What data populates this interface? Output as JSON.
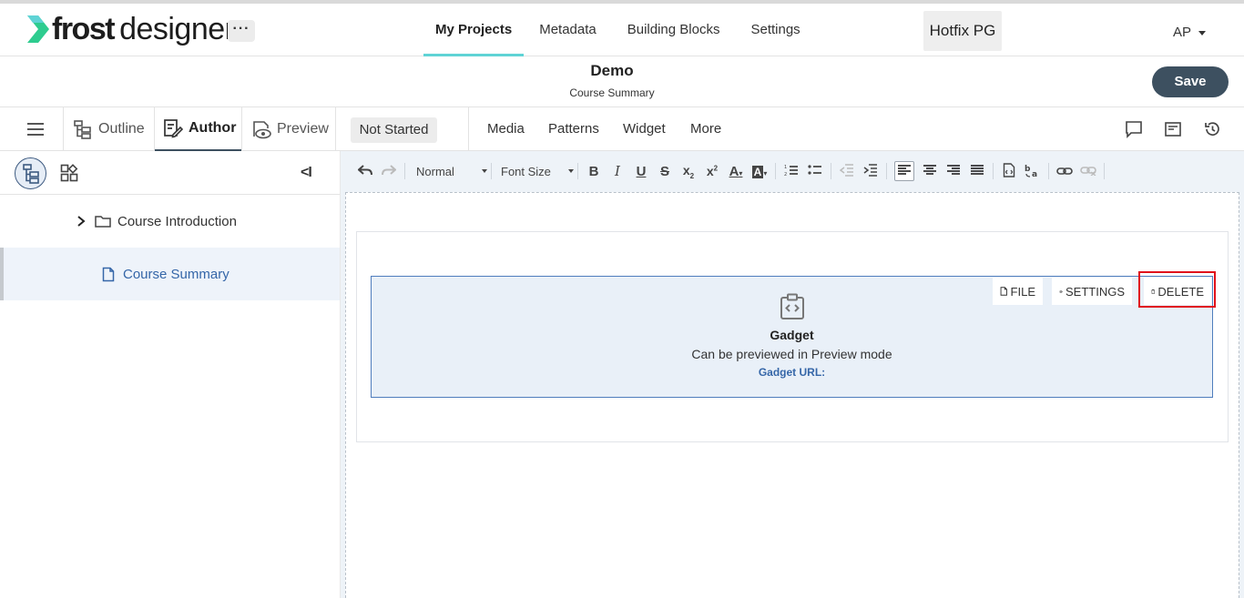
{
  "header": {
    "logo_bold": "frost",
    "logo_light": "designer",
    "more_label": "···",
    "nav": [
      "My Projects",
      "Metadata",
      "Building Blocks",
      "Settings"
    ],
    "project": "Hotfix PG",
    "user": "AP"
  },
  "document": {
    "title": "Demo",
    "subtitle": "Course Summary",
    "save_label": "Save"
  },
  "modes": {
    "outline": "Outline",
    "author": "Author",
    "preview": "Preview",
    "status": "Not Started",
    "insert": [
      "Media",
      "Patterns",
      "Widget",
      "More"
    ]
  },
  "sidebar": {
    "collapse_label": "<I",
    "items": [
      {
        "label": "Course Introduction"
      },
      {
        "label": "Course Summary"
      }
    ]
  },
  "toolbar": {
    "format": "Normal",
    "font_size": "Font Size"
  },
  "gadget": {
    "file_label": "FILE",
    "settings_label": "SETTINGS",
    "delete_label": "DELETE",
    "title": "Gadget",
    "description": "Can be previewed in Preview mode",
    "url_label": "Gadget URL:"
  },
  "colors": {
    "accent": "#5fd3d5",
    "primary": "#3d5060",
    "link": "#3566a8",
    "highlight": "#e0111b"
  }
}
